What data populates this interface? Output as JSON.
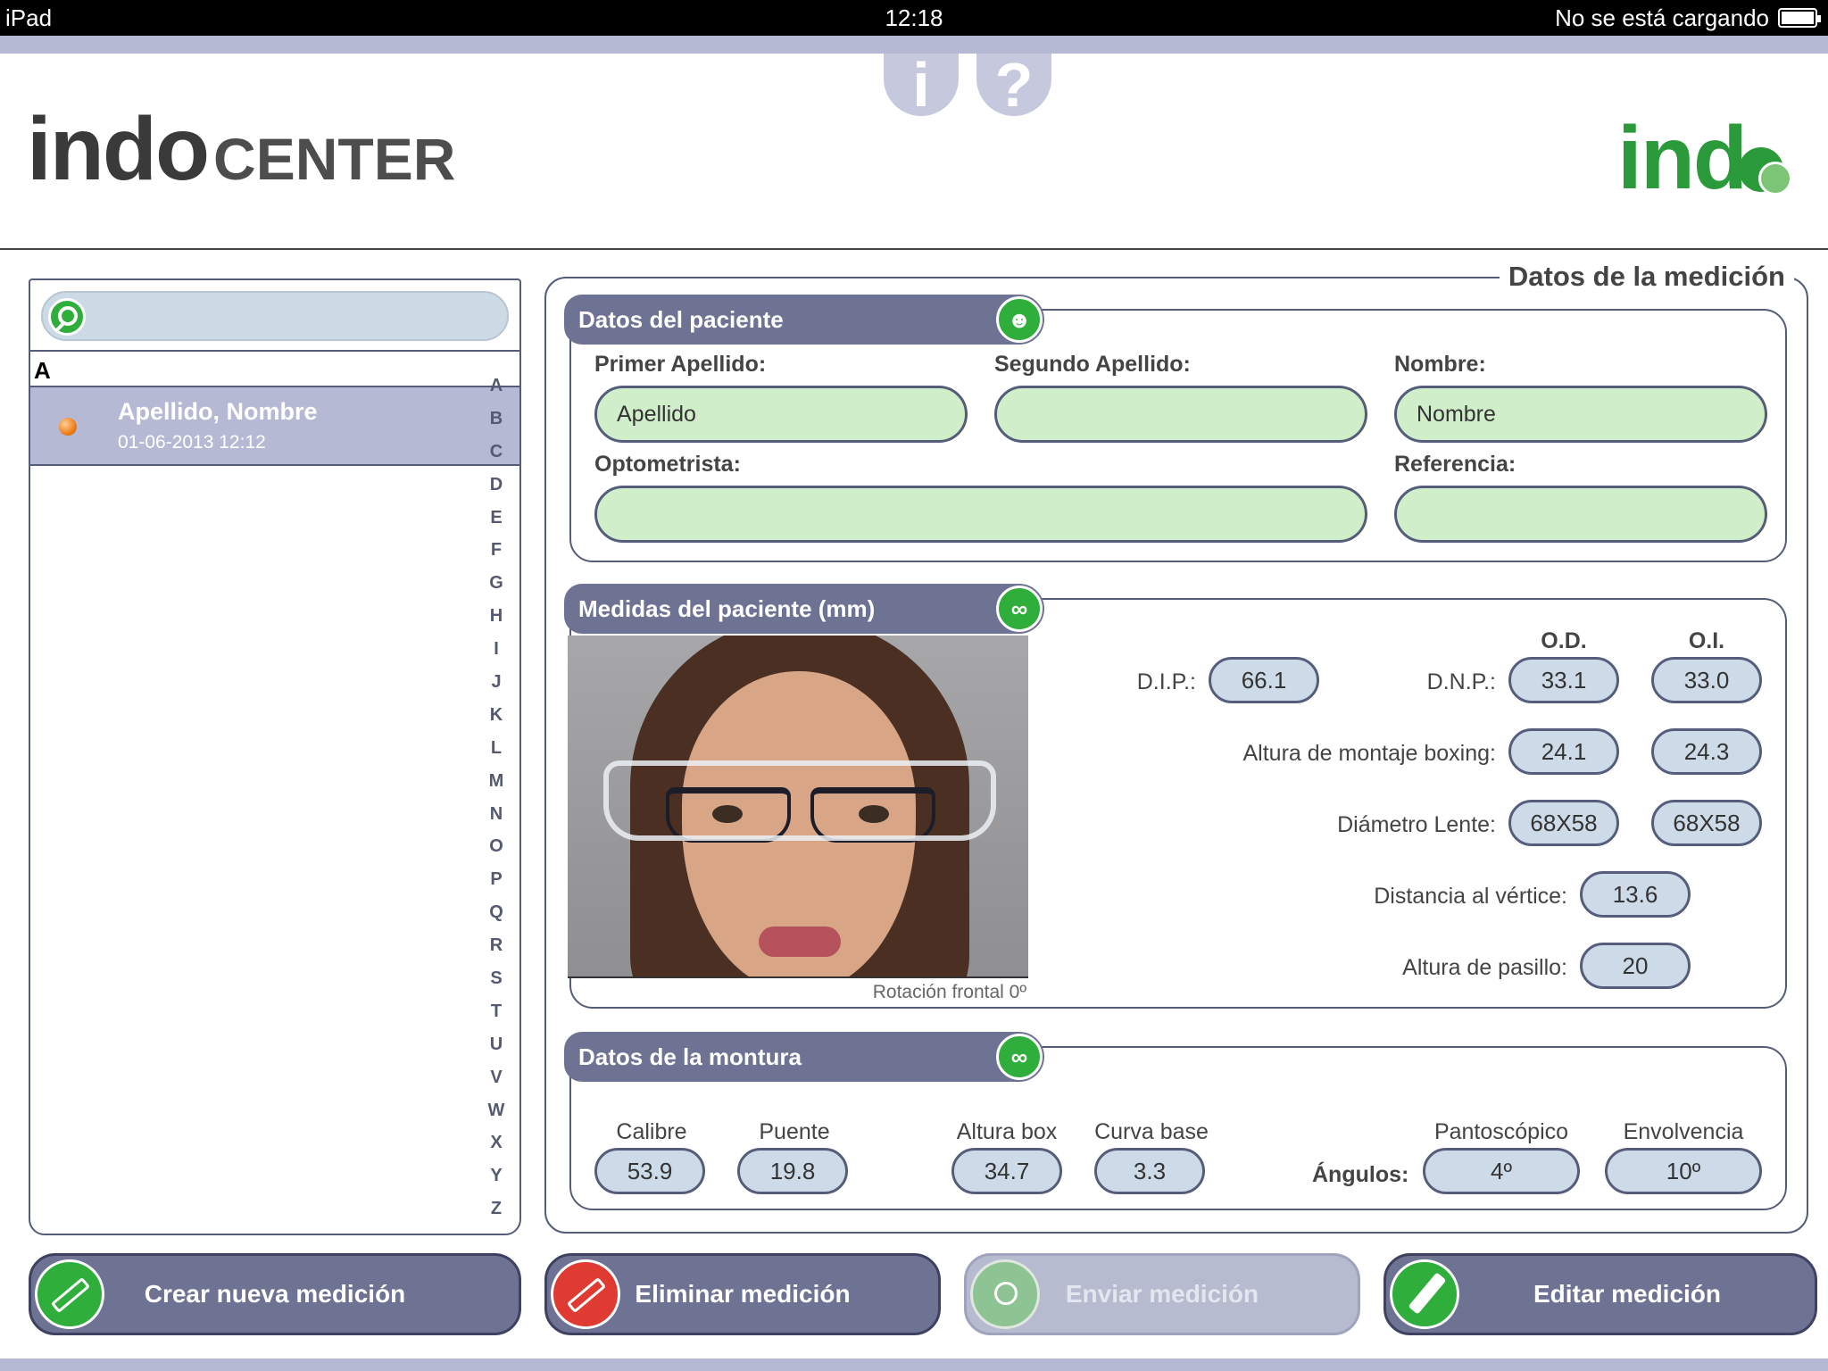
{
  "status_bar": {
    "device": "iPad",
    "time": "12:18",
    "battery_text": "No se está cargando"
  },
  "header": {
    "logo_left_part1": "indo",
    "logo_left_part2": "CENTER",
    "info_label": "i",
    "help_label": "?",
    "logo_right": "ind"
  },
  "sidebar": {
    "search_placeholder": "",
    "section_letter": "A",
    "items": [
      {
        "name": "Apellido, Nombre",
        "date": "01-06-2013 12:12"
      }
    ],
    "index": [
      "A",
      "B",
      "C",
      "D",
      "E",
      "F",
      "G",
      "H",
      "I",
      "J",
      "K",
      "L",
      "M",
      "N",
      "O",
      "P",
      "Q",
      "R",
      "S",
      "T",
      "U",
      "V",
      "W",
      "X",
      "Y",
      "Z"
    ]
  },
  "main": {
    "title": "Datos de la medición",
    "patient": {
      "tab_label": "Datos del paciente",
      "primer_apellido_label": "Primer Apellido:",
      "primer_apellido_value": "Apellido",
      "segundo_apellido_label": "Segundo Apellido:",
      "segundo_apellido_value": "",
      "nombre_label": "Nombre:",
      "nombre_value": "Nombre",
      "optometrista_label": "Optometrista:",
      "optometrista_value": "",
      "referencia_label": "Referencia:",
      "referencia_value": ""
    },
    "measurements": {
      "tab_label": "Medidas del paciente (mm)",
      "photo_caption": "Rotación frontal 0º",
      "od_header": "O.D.",
      "oi_header": "O.I.",
      "dip_label": "D.I.P.:",
      "dip_value": "66.1",
      "dnp_label": "D.N.P.:",
      "dnp_od": "33.1",
      "dnp_oi": "33.0",
      "altura_label": "Altura de montaje boxing:",
      "altura_od": "24.1",
      "altura_oi": "24.3",
      "diametro_label": "Diámetro Lente:",
      "diametro_od": "68X58",
      "diametro_oi": "68X58",
      "vertice_label": "Distancia al vértice:",
      "vertice_value": "13.6",
      "pasillo_label": "Altura de pasillo:",
      "pasillo_value": "20"
    },
    "frame": {
      "tab_label": "Datos de la montura",
      "calibre_label": "Calibre",
      "calibre_value": "53.9",
      "puente_label": "Puente",
      "puente_value": "19.8",
      "altura_box_label": "Altura box",
      "altura_box_value": "34.7",
      "curva_label": "Curva base",
      "curva_value": "3.3",
      "angulos_label": "Ángulos:",
      "panto_label": "Pantoscópico",
      "panto_value": "4º",
      "envol_label": "Envolvencia",
      "envol_value": "10º"
    }
  },
  "actions": {
    "create": "Crear nueva medición",
    "delete": "Eliminar medición",
    "send": "Enviar medición",
    "edit": "Editar medición"
  }
}
